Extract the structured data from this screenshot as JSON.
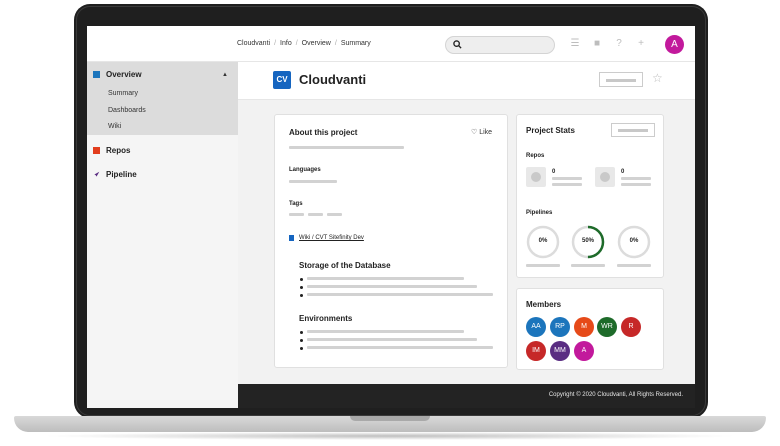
{
  "breadcrumb": [
    "Cloudvanti",
    "Info",
    "Overview",
    "Summary"
  ],
  "top_icons": [
    "list-icon",
    "bag-icon",
    "help-icon",
    "add-user-icon"
  ],
  "user_avatar": "A",
  "sidebar": {
    "overview": "Overview",
    "sub": [
      "Summary",
      "Dashboards",
      "Wiki"
    ],
    "repos": "Repos",
    "pipeline": "Pipeline"
  },
  "header": {
    "logo": "CV",
    "title": "Cloudvanti"
  },
  "about": {
    "title": "About this project",
    "like": "Like",
    "languages": "Languages",
    "tags": "Tags",
    "wiki_link": "Wiki / CVT Sitefinity Dev",
    "storage": "Storage of the Database",
    "environments": "Environments"
  },
  "stats": {
    "title": "Project Stats",
    "repos_label": "Repos",
    "repo_counts": [
      "0",
      "0"
    ],
    "pipelines_label": "Pipelines",
    "pipelines": [
      "0%",
      "50%",
      "0%"
    ],
    "pipeline_fill": [
      0,
      0.5,
      0
    ],
    "pipeline_color": "#1e6b2a"
  },
  "members": {
    "title": "Members",
    "list": [
      {
        "initials": "AA",
        "color": "#1c75bc"
      },
      {
        "initials": "RP",
        "color": "#1c75bc"
      },
      {
        "initials": "M",
        "color": "#e64a19"
      },
      {
        "initials": "WR",
        "color": "#1e6b2a"
      },
      {
        "initials": "R",
        "color": "#c62828"
      },
      {
        "initials": "IM",
        "color": "#c62828"
      },
      {
        "initials": "MM",
        "color": "#5a2d82"
      },
      {
        "initials": "A",
        "color": "#c2199c"
      }
    ]
  },
  "footer": "Copyright © 2020 Cloudvanti, All Rights Reserved."
}
